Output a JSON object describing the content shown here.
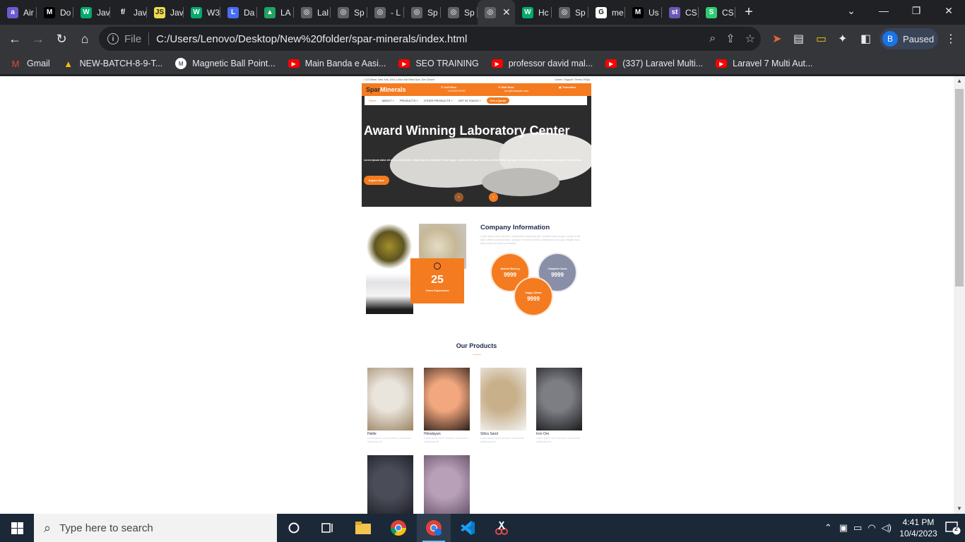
{
  "browser": {
    "tabs": [
      {
        "label": "Air",
        "icon": "aircall-icon",
        "color": "#6b5bd2",
        "glyph": "a"
      },
      {
        "label": "Do",
        "icon": "medium-icon",
        "color": "#000000",
        "glyph": "M"
      },
      {
        "label": "Jav",
        "icon": "w3schools-icon",
        "color": "#04aa6d",
        "glyph": "W"
      },
      {
        "label": "Jav",
        "icon": "script-icon",
        "color": "#202124",
        "glyph": "f/"
      },
      {
        "label": "Jav",
        "icon": "js-icon",
        "color": "#f0db4f",
        "glyph": "JS"
      },
      {
        "label": "W3",
        "icon": "w3schools-icon",
        "color": "#04aa6d",
        "glyph": "W"
      },
      {
        "label": "Da",
        "icon": "laravel-doc-icon",
        "color": "#4a6cf7",
        "glyph": "L"
      },
      {
        "label": "LA",
        "icon": "google-drive-icon",
        "color": "#1fa463",
        "glyph": "▲"
      },
      {
        "label": "Lal",
        "icon": "globe-icon",
        "color": "#5f6368",
        "glyph": "◎"
      },
      {
        "label": "Sp",
        "icon": "globe-icon",
        "color": "#5f6368",
        "glyph": "◎"
      },
      {
        "label": "- L",
        "icon": "globe-icon",
        "color": "#5f6368",
        "glyph": "◎"
      },
      {
        "label": "Sp",
        "icon": "globe-icon",
        "color": "#5f6368",
        "glyph": "◎"
      },
      {
        "label": "Sp",
        "icon": "globe-icon",
        "color": "#5f6368",
        "glyph": "◎"
      },
      {
        "label": "",
        "icon": "globe-icon",
        "color": "#5f6368",
        "glyph": "◎",
        "active": true
      },
      {
        "label": "Hc",
        "icon": "w3schools-icon",
        "color": "#04aa6d",
        "glyph": "W"
      },
      {
        "label": "Sp",
        "icon": "globe-icon",
        "color": "#5f6368",
        "glyph": "◎"
      },
      {
        "label": "me",
        "icon": "google-icon",
        "color": "#ffffff",
        "glyph": "G"
      },
      {
        "label": "Us",
        "icon": "medium-icon",
        "color": "#000000",
        "glyph": "M"
      },
      {
        "label": "CS",
        "icon": "stackblitz-icon",
        "color": "#6b57b5",
        "glyph": "st"
      },
      {
        "label": "CS",
        "icon": "codesandbox-icon",
        "color": "#2ecc71",
        "glyph": "S"
      }
    ],
    "address": {
      "scheme_label": "File",
      "url": "C:/Users/Lenovo/Desktop/New%20folder/spar-minerals/index.html"
    },
    "profile": {
      "initial": "B",
      "status": "Paused"
    },
    "bookmarks": [
      {
        "label": "Gmail",
        "icon": "gmail-icon",
        "color": "#ea4335"
      },
      {
        "label": "NEW-BATCH-8-9-T...",
        "icon": "google-drive-icon",
        "color": "#fbbc04"
      },
      {
        "label": "Magnetic Ball Point...",
        "icon": "medium-icon",
        "color": "#ffffff"
      },
      {
        "label": "Main Banda e Aasi...",
        "icon": "youtube-icon",
        "color": "#ff0000"
      },
      {
        "label": "SEO TRAINING",
        "icon": "youtube-icon",
        "color": "#ff0000"
      },
      {
        "label": "professor david mal...",
        "icon": "youtube-icon",
        "color": "#ff0000"
      },
      {
        "label": "(337) Laravel Multi...",
        "icon": "youtube-icon",
        "color": "#ff0000"
      },
      {
        "label": "Laravel 7 Multi Aut...",
        "icon": "youtube-icon",
        "color": "#ff0000"
      }
    ]
  },
  "site": {
    "topbar": {
      "address": "123 Street, New York, USA",
      "hours": "Mon-Sat 09am-5pm, Sun Closed",
      "links": "Career  /  Support  /  Terms  /  FAQs"
    },
    "brand": {
      "part1": "Spar",
      "part2": "Minerals"
    },
    "call": {
      "label": "Call Now:",
      "value": "+012345 6789"
    },
    "mail": {
      "label": "Mail Now:",
      "value": "info@example.com"
    },
    "translator": "Translator",
    "nav": {
      "home": "Home",
      "about": "ABOUT",
      "products": "PRODUCTS",
      "other": "OTHER PRODUCTS",
      "contact": "GET IN TOUCH",
      "quote": "Get a Quote"
    },
    "hero": {
      "title": "Award Winning Laboratory Center",
      "text": "Lorem ipsum dolor sit amet, consectetur adipiscing elit. Curabitur tellus augue, iaculis id elit eget, ultrices pulvinar tortor. Quisque vel lorem porttitor, malesuada arcu quis, fringilla risus.",
      "button": "Explore More",
      "prev": "‹",
      "next": "›"
    },
    "experience": {
      "number": "25",
      "label": "Years Experience"
    },
    "company": {
      "title": "Company Information",
      "text": "Lorem ipsum dolor sit amet, consectetur adipiscing elit. Curabitur tellus augue, iaculis id elit eget, ultrices pulvinar tortor. Quisque vel lorem porttitor, malesuada arcu quis, fringilla risus. Ipsum dolor sit amet consectetur."
    },
    "stats": [
      {
        "label": "Awards Winning",
        "value": "9999",
        "color": "#f47b20"
      },
      {
        "label": "Complete Cases",
        "value": "9999",
        "color": "#8a8fa8"
      },
      {
        "label": "Happy Clients",
        "value": "9999",
        "color": "#f47b20"
      }
    ],
    "products_title": "Our Products",
    "products": [
      {
        "name": "Halite",
        "desc": "Lorem ipsum dolor sit amet, consectetur adipiscing elit.",
        "color1": "#e9e4dc",
        "color2": "#9c8463"
      },
      {
        "name": "Himalayan",
        "desc": "Lorem ipsum dolor sit amet, consectetur adipiscing elit.",
        "color1": "#f2a77e",
        "color2": "#2a1d18"
      },
      {
        "name": "Silica Sand",
        "desc": "Lorem ipsum dolor sit amet, consectetur adipiscing elit.",
        "color1": "#c8b08a",
        "color2": "#f4f4f4"
      },
      {
        "name": "Iron Ore",
        "desc": "Lorem ipsum dolor sit amet, consectetur adipiscing elit.",
        "color1": "#7c7e84",
        "color2": "#1a1a1c"
      },
      {
        "name": "",
        "desc": "",
        "color1": "#4a4c58",
        "color2": "#1a1b22"
      },
      {
        "name": "",
        "desc": "",
        "color1": "#b8a0b8",
        "color2": "#5e4b60"
      }
    ]
  },
  "taskbar": {
    "search_placeholder": "Type here to search",
    "time": "4:41 PM",
    "date": "10/4/2023",
    "notifications": "2"
  }
}
